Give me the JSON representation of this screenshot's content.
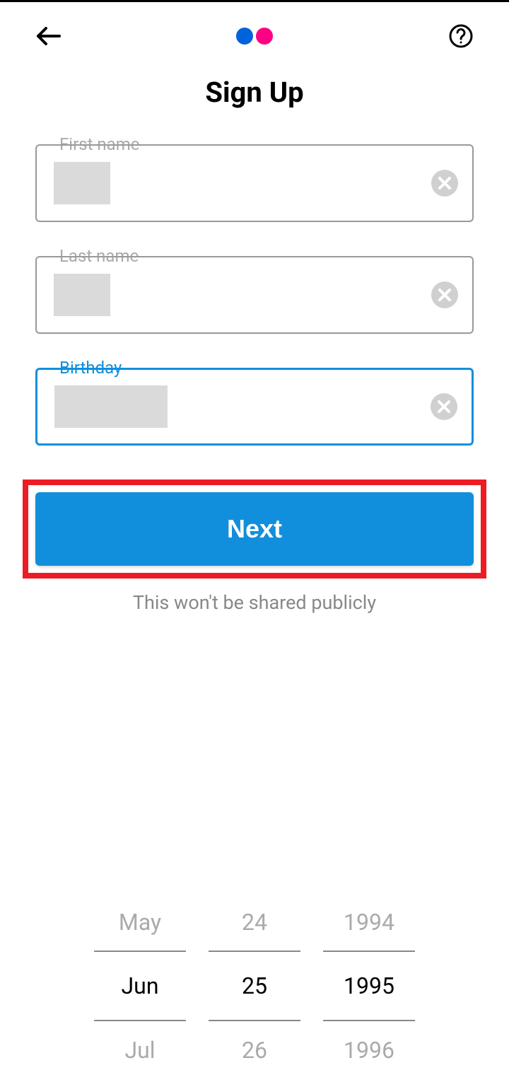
{
  "header": {
    "back_icon": "back",
    "help_icon": "help"
  },
  "title": "Sign Up",
  "fields": {
    "first_name": {
      "label": "First name"
    },
    "last_name": {
      "label": "Last name"
    },
    "birthday": {
      "label": "Birthday"
    }
  },
  "next_button": "Next",
  "disclaimer": "This won't be shared publicly",
  "date_picker": {
    "month": {
      "prev": "May",
      "current": "Jun",
      "next": "Jul"
    },
    "day": {
      "prev": "24",
      "current": "25",
      "next": "26"
    },
    "year": {
      "prev": "1994",
      "current": "1995",
      "next": "1996"
    }
  }
}
